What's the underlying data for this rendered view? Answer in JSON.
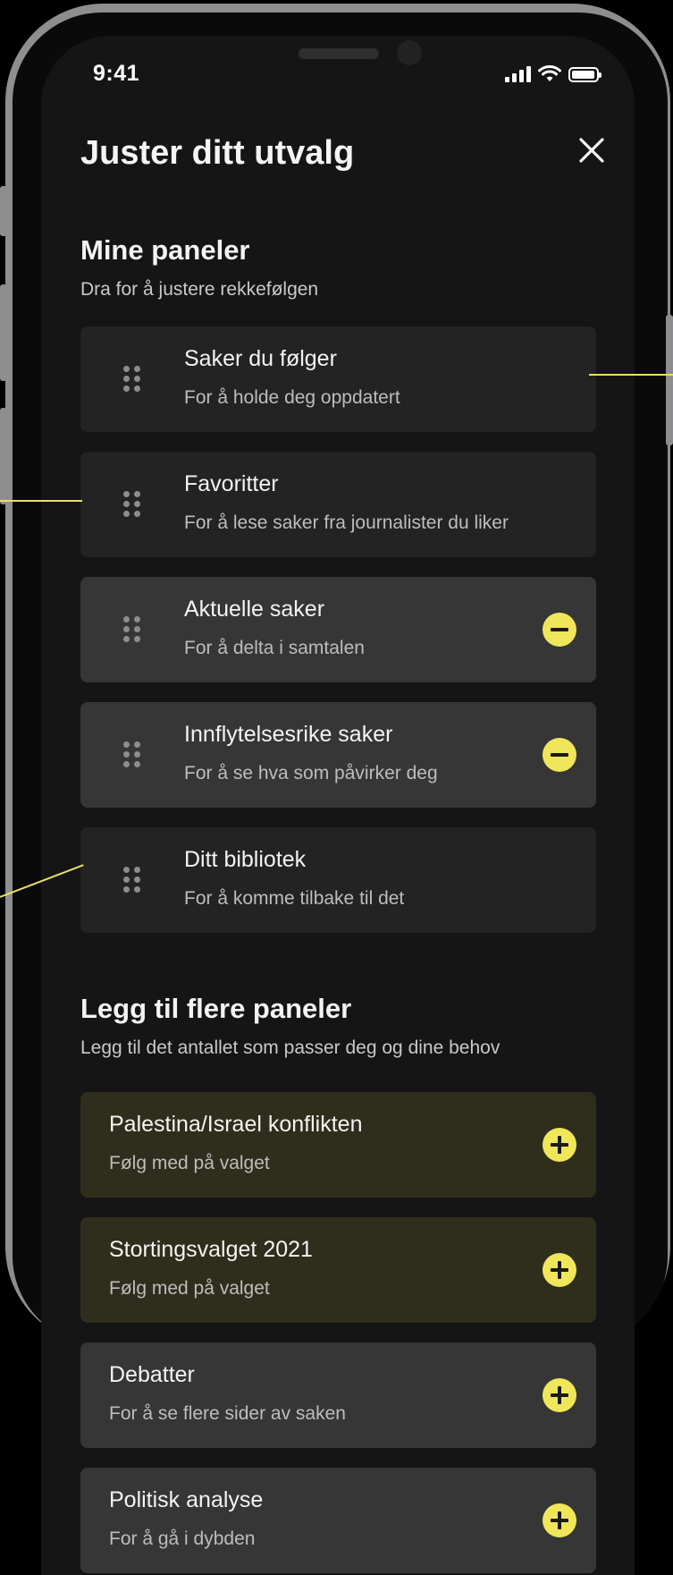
{
  "status_bar": {
    "time": "9:41"
  },
  "header": {
    "title": "Juster ditt utvalg"
  },
  "my_panels": {
    "title": "Mine paneler",
    "subtitle": "Dra for å justere rekkefølgen",
    "items": [
      {
        "title": "Saker du følger",
        "subtitle": "For å holde deg oppdatert",
        "removable": false
      },
      {
        "title": "Favoritter",
        "subtitle": "For å lese saker fra journalister du liker",
        "removable": false
      },
      {
        "title": "Aktuelle saker",
        "subtitle": "For å delta i samtalen",
        "removable": true
      },
      {
        "title": "Innflytelsesrike saker",
        "subtitle": "For å se hva som påvirker deg",
        "removable": true
      },
      {
        "title": "Ditt bibliotek",
        "subtitle": "For å komme tilbake til det",
        "removable": false
      }
    ]
  },
  "add_panels": {
    "title": "Legg til flere paneler",
    "subtitle": "Legg til det antallet som passer deg og dine behov",
    "items": [
      {
        "title": "Palestina/Israel konflikten",
        "subtitle": "Følg med på valget",
        "highlighted": true
      },
      {
        "title": "Stortingsvalget 2021",
        "subtitle": "Følg med på valget",
        "highlighted": true
      },
      {
        "title": "Debatter",
        "subtitle": "For å se flere sider av saken",
        "highlighted": false
      },
      {
        "title": "Politisk analyse",
        "subtitle": "For å gå i dybden",
        "highlighted": false
      }
    ]
  },
  "colors": {
    "accent": "#f0e65a",
    "background": "#151515",
    "card_dark": "#232323",
    "card_grey": "#363636",
    "card_highlight": "#2f2d1c"
  }
}
